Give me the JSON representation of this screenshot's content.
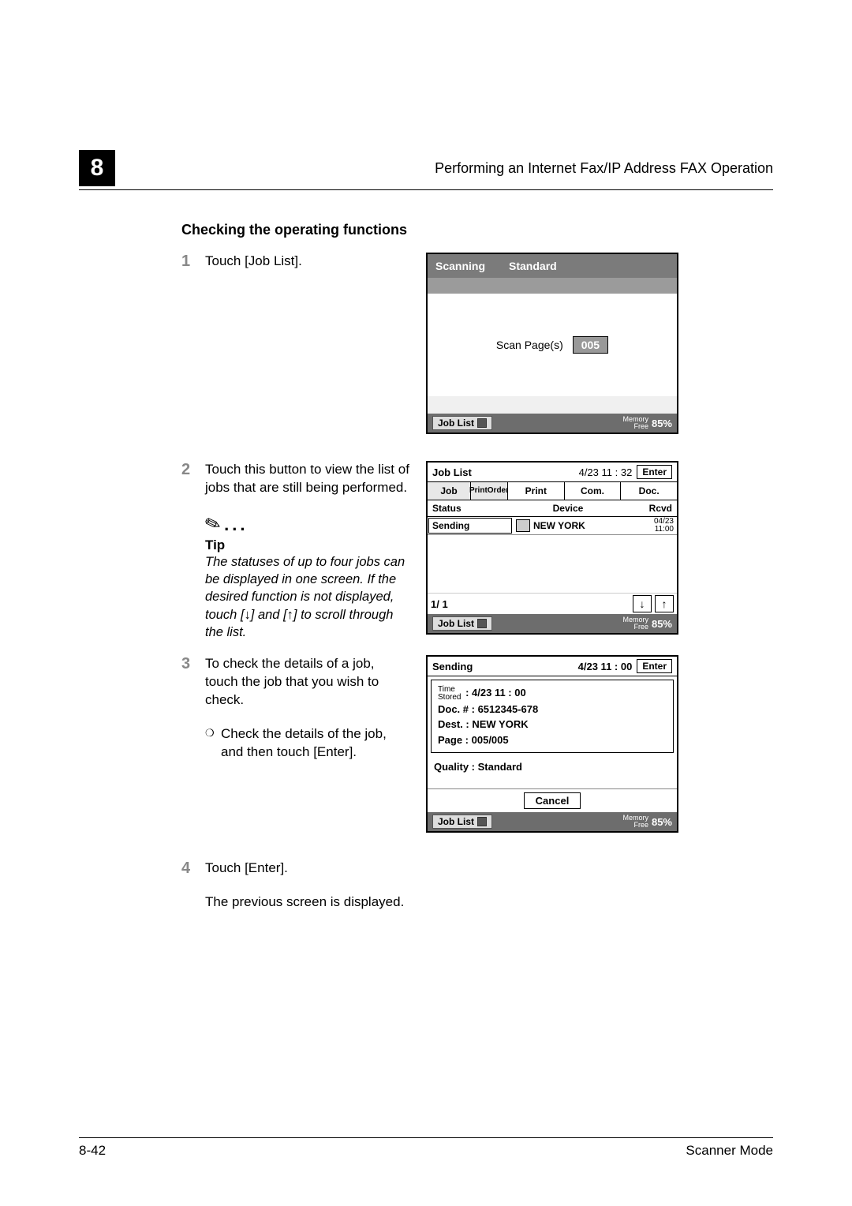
{
  "header": {
    "chapter": "8",
    "title": "Performing an Internet Fax/IP Address FAX Operation"
  },
  "section_title": "Checking the operating functions",
  "steps": {
    "s1": {
      "num": "1",
      "text": "Touch [Job List]."
    },
    "s2": {
      "num": "2",
      "text": "Touch this button to view the list of jobs that are still being performed."
    },
    "s3": {
      "num": "3",
      "text": "To check the details of a job, touch the job that you wish to check."
    },
    "s3_sub": "Check the details of the job, and then touch [Enter].",
    "s4_a": {
      "num": "4",
      "text": "Touch [Enter]."
    },
    "s4_b": "The previous screen is displayed."
  },
  "tip": {
    "label": "Tip",
    "text": "The statuses of up to four jobs can be displayed in one screen. If the desired function is not displayed, touch [↓] and [↑] to scroll through the list."
  },
  "screen1": {
    "mode": "Scanning",
    "quality": "Standard",
    "scanpages_label": "Scan Page(s)",
    "scanpages_value": "005",
    "joblist": "Job List",
    "memory_label": "Memory\nFree",
    "memory_pct": "85%"
  },
  "screen2": {
    "title": "Job List",
    "timestamp": "4/23 11 : 32",
    "enter": "Enter",
    "tabs": {
      "job": "Job",
      "po1": "Print",
      "po2": "Order",
      "print": "Print",
      "com": "Com.",
      "doc": "Doc."
    },
    "hdr": {
      "status": "Status",
      "device": "Device",
      "rcvd": "Rcvd"
    },
    "row": {
      "status": "Sending",
      "dest": "NEW YORK",
      "r1": "04/23",
      "r2": "11:00"
    },
    "pager": "1/ 1",
    "joblist": "Job List",
    "memory_label": "Memory\nFree",
    "memory_pct": "85%"
  },
  "screen3": {
    "title": "Sending",
    "timestamp": "4/23 11 : 00",
    "enter": "Enter",
    "time_lbl1": "Time",
    "time_lbl2": "Stored",
    "time_val": ": 4/23  11 : 00",
    "doc": "Doc. # : 6512345-678",
    "dest": "Dest. : NEW YORK",
    "page": "Page : 005/005",
    "quality": "Quality : Standard",
    "cancel": "Cancel",
    "joblist": "Job List",
    "memory_label": "Memory\nFree",
    "memory_pct": "85%"
  },
  "footer": {
    "left": "8-42",
    "right": "Scanner Mode"
  }
}
